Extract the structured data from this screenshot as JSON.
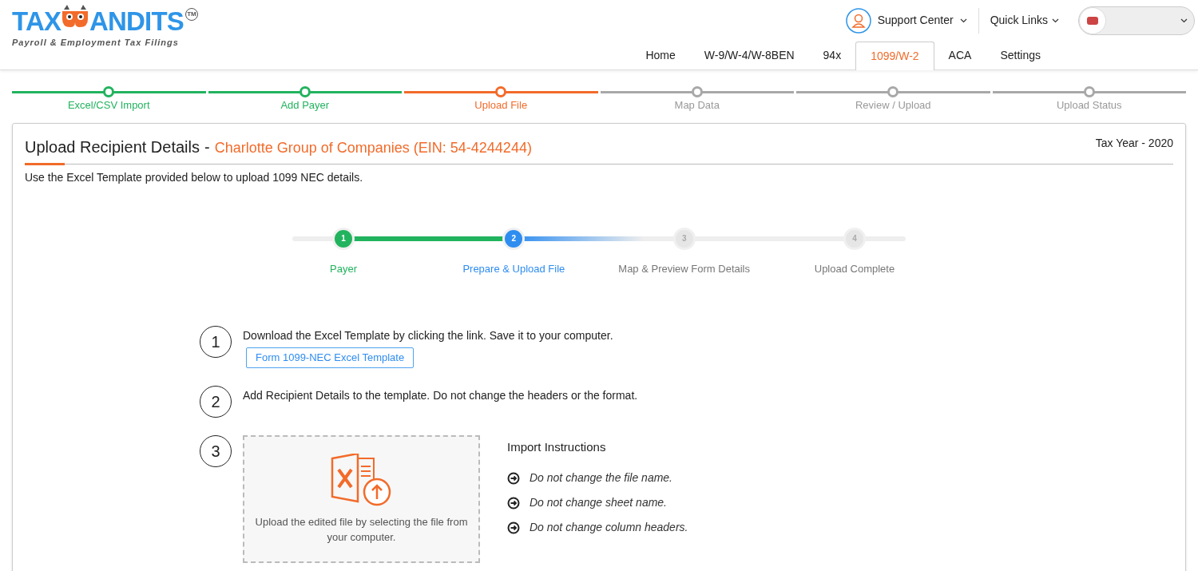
{
  "logo": {
    "left": "TAX",
    "right": "ANDITS",
    "tm": "TM",
    "tagline": "Payroll & Employment Tax Filings"
  },
  "header": {
    "support": "Support Center",
    "quick_links": "Quick Links"
  },
  "nav": [
    {
      "label": "Home",
      "selected": false
    },
    {
      "label": "W-9/W-4/W-8BEN",
      "selected": false
    },
    {
      "label": "94x",
      "selected": false
    },
    {
      "label": "1099/W-2",
      "selected": true
    },
    {
      "label": "ACA",
      "selected": false
    },
    {
      "label": "Settings",
      "selected": false
    }
  ],
  "progress": [
    {
      "label": "Excel/CSV Import",
      "completed": true,
      "current": false
    },
    {
      "label": "Add Payer",
      "completed": true,
      "current": false
    },
    {
      "label": "Upload File",
      "completed": false,
      "current": true
    },
    {
      "label": "Map Data",
      "completed": false,
      "current": false
    },
    {
      "label": "Review / Upload",
      "completed": false,
      "current": false
    },
    {
      "label": "Upload Status",
      "completed": false,
      "current": false
    }
  ],
  "card": {
    "title": "Upload Recipient Details",
    "separator": "-",
    "company": "Charlotte Group of Companies (EIN: 54-4244244)",
    "tax_year": "Tax Year - 2020",
    "subtitle": "Use the Excel Template provided below to upload 1099 NEC details."
  },
  "stepper": [
    {
      "number": "1",
      "label": "Payer",
      "completed": true,
      "current": false
    },
    {
      "number": "2",
      "label": "Prepare & Upload File",
      "completed": false,
      "current": true
    },
    {
      "number": "3",
      "label": "Map & Preview Form Details",
      "completed": false,
      "current": false
    },
    {
      "number": "4",
      "label": "Upload Complete",
      "completed": false,
      "current": false
    }
  ],
  "instructions": [
    {
      "number": "1",
      "text": "Download the Excel Template by clicking the link. Save it to your computer.",
      "link": "Form 1099-NEC Excel Template"
    },
    {
      "number": "2",
      "text": "Add Recipient Details to the template. Do not change the headers or the format."
    },
    {
      "number": "3",
      "upload_text": "Upload the edited file by selecting the file from your computer."
    }
  ],
  "import_instructions": {
    "title": "Import Instructions",
    "items": [
      "Do not change the file name.",
      "Do not change sheet name.",
      "Do not change column headers."
    ]
  }
}
